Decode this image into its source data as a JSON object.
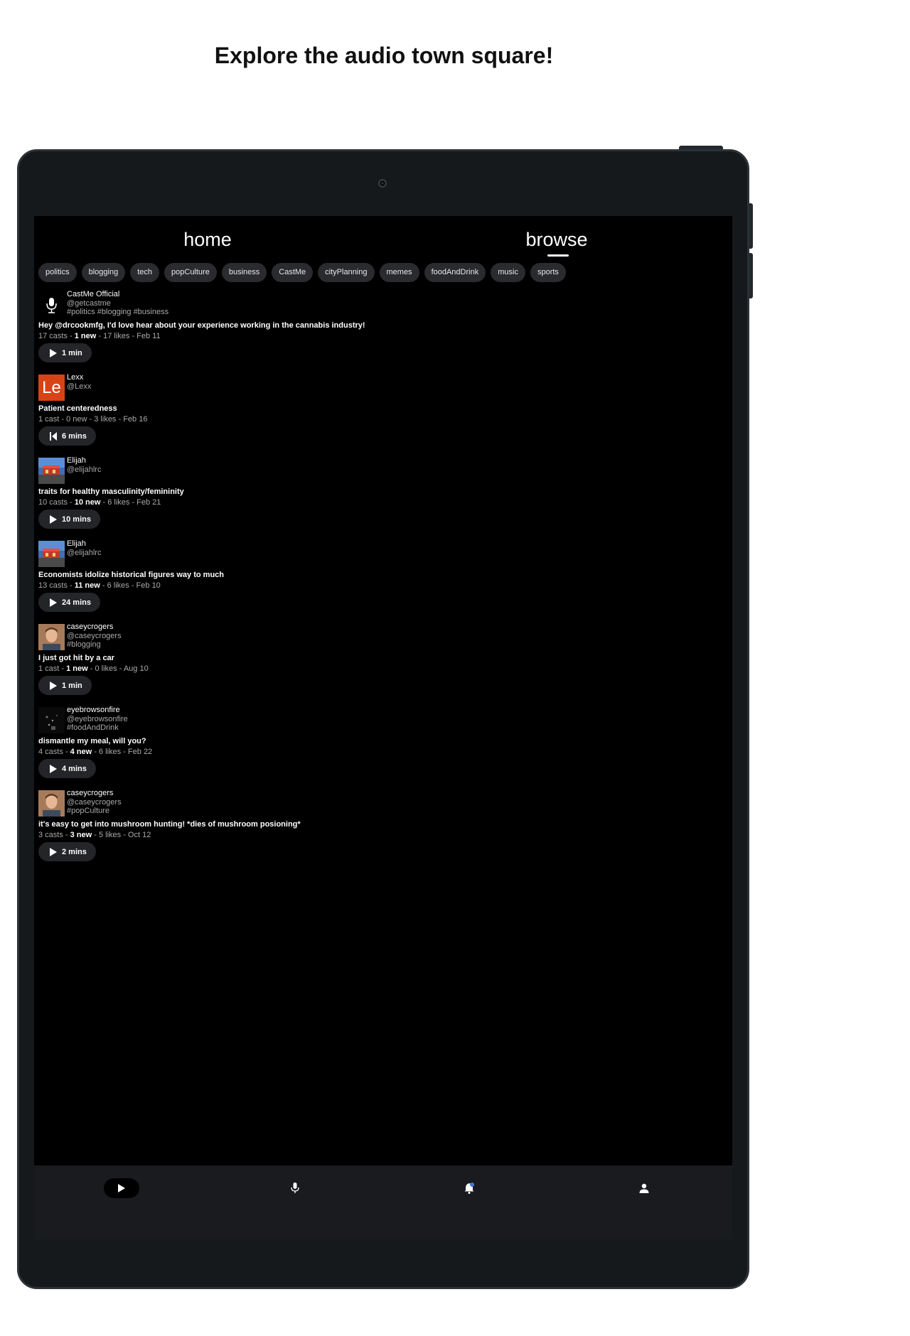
{
  "headline": "Explore the audio town square!",
  "tabs": {
    "home": "home",
    "browse": "browse",
    "active": "browse"
  },
  "chips": [
    "politics",
    "blogging",
    "tech",
    "popCulture",
    "business",
    "CastMe",
    "cityPlanning",
    "memes",
    "foodAndDrink",
    "music",
    "sports"
  ],
  "posts": [
    {
      "name": "CastMe Official",
      "handle": "@getcastme",
      "tags": "#politics #blogging #business",
      "title": "Hey @drcookmfg, I'd love hear about your experience working in the cannabis industry!",
      "casts": "17 casts - ",
      "new": "1 new",
      "rest": " - 17 likes - Feb 11",
      "duration": "1 min",
      "avatar": "mic-icon",
      "control": "play"
    },
    {
      "name": "Lexx",
      "handle": "@Lexx",
      "tags": "",
      "title": "Patient centeredness",
      "casts": "1 cast - 0 new - 3 likes - Feb 16",
      "new": "",
      "rest": "",
      "duration": "6 mins",
      "avatar": "Le",
      "control": "restart"
    },
    {
      "name": "Elijah",
      "handle": "@elijahlrc",
      "tags": "",
      "title": "traits for healthy masculinity/femininity",
      "casts": "10 casts - ",
      "new": "10 new",
      "rest": " - 6 likes - Feb 21",
      "duration": "10 mins",
      "avatar": "photo-elijah",
      "control": "play"
    },
    {
      "name": "Elijah",
      "handle": "@elijahlrc",
      "tags": "",
      "title": "Economists idolize historical figures way to much",
      "casts": "13 casts - ",
      "new": "11 new",
      "rest": " - 6 likes - Feb 10",
      "duration": "24 mins",
      "avatar": "photo-elijah",
      "control": "play"
    },
    {
      "name": "caseycrogers",
      "handle": "@caseycrogers",
      "tags": "#blogging",
      "title": "I just got hit by a car",
      "casts": "1 cast - ",
      "new": "1 new",
      "rest": " - 0 likes - Aug 10",
      "duration": "1 min",
      "avatar": "photo-casey",
      "control": "play"
    },
    {
      "name": "eyebrowsonfire",
      "handle": "@eyebrowsonfire",
      "tags": "#foodAndDrink",
      "title": "dismantle my meal, will you?",
      "casts": "4 casts - ",
      "new": "4 new",
      "rest": " - 6 likes - Feb 22",
      "duration": "4 mins",
      "avatar": "photo-dark",
      "control": "play"
    },
    {
      "name": "caseycrogers",
      "handle": "@caseycrogers",
      "tags": "#popCulture",
      "title": "it's easy to get into mushroom hunting! *dies of mushroom posioning*",
      "casts": "3 casts - ",
      "new": "3 new",
      "rest": " - 5 likes - Oct 12",
      "duration": "2 mins",
      "avatar": "photo-casey",
      "control": "play"
    }
  ],
  "bottom_nav": [
    "play-icon",
    "mic-icon",
    "bell-icon",
    "person-icon"
  ],
  "colors": {
    "screen_bg": "#000000",
    "chip_bg": "#2a2b2f",
    "nav_bg": "#1a1b1f",
    "lexx_avatar": "#d84315",
    "notification_dot": "#3d7bd9"
  }
}
